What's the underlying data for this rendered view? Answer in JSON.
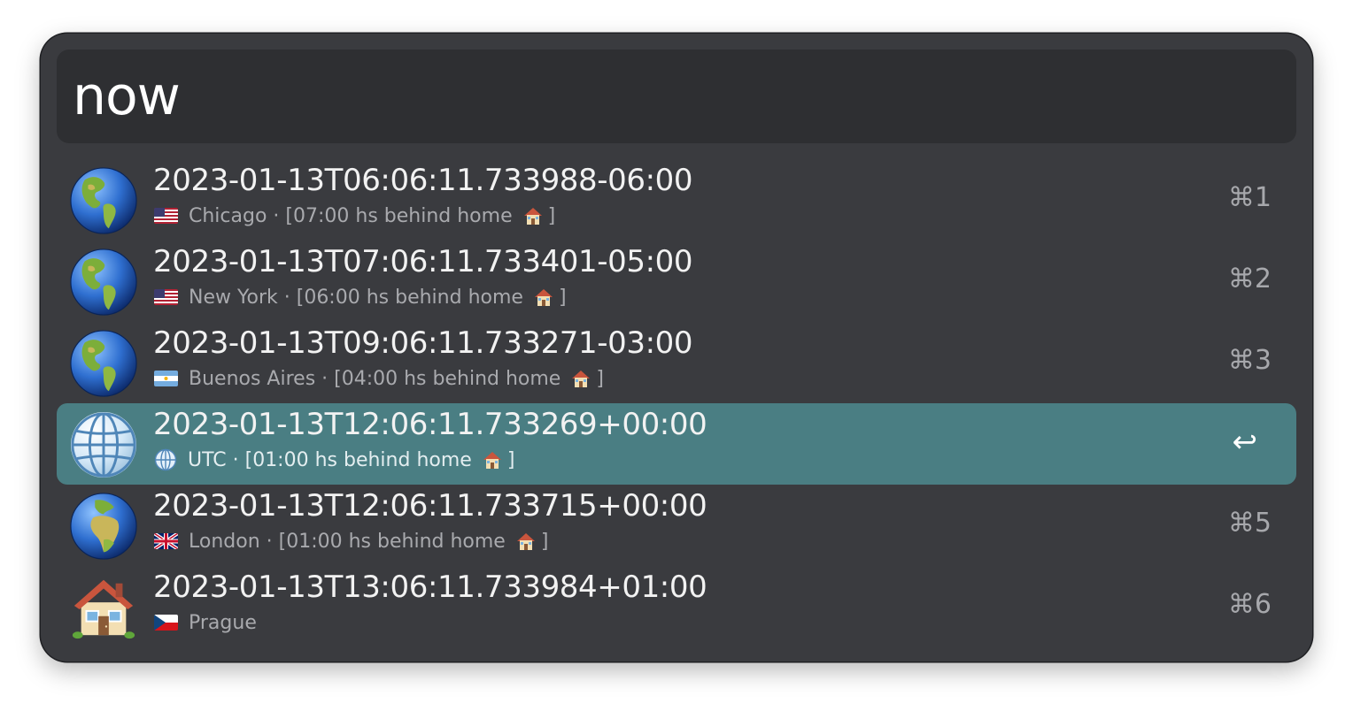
{
  "search": {
    "value": "now"
  },
  "results": [
    {
      "icon": "globe-americas-icon",
      "title": "2023-01-13T06:06:11.733988-06:00",
      "flag": "us-flag-icon",
      "city": "Chicago",
      "separator": " · ",
      "offset": "[07:00 hs behind home",
      "home_emoji": "house-icon",
      "close": "]",
      "shortcut": "⌘1"
    },
    {
      "icon": "globe-americas-icon",
      "title": "2023-01-13T07:06:11.733401-05:00",
      "flag": "us-flag-icon",
      "city": "New York",
      "separator": " · ",
      "offset": "[06:00 hs behind home",
      "home_emoji": "house-icon",
      "close": "]",
      "shortcut": "⌘2"
    },
    {
      "icon": "globe-americas-icon",
      "title": "2023-01-13T09:06:11.733271-03:00",
      "flag": "ar-flag-icon",
      "city": "Buenos Aires",
      "separator": " · ",
      "offset": "[04:00 hs behind home",
      "home_emoji": "house-icon",
      "close": "]",
      "shortcut": "⌘3"
    },
    {
      "icon": "globe-meridians-icon",
      "title": "2023-01-13T12:06:11.733269+00:00",
      "flag": "globe-meridians-icon",
      "city": "UTC",
      "separator": " · ",
      "offset": "[01:00 hs behind home",
      "home_emoji": "house-icon",
      "close": "]",
      "shortcut": "↩",
      "selected": true
    },
    {
      "icon": "globe-europe-africa-icon",
      "title": "2023-01-13T12:06:11.733715+00:00",
      "flag": "uk-flag-icon",
      "city": "London",
      "separator": " · ",
      "offset": "[01:00 hs behind home",
      "home_emoji": "house-icon",
      "close": "]",
      "shortcut": "⌘5"
    },
    {
      "icon": "house-icon",
      "title": "2023-01-13T13:06:11.733984+01:00",
      "flag": "cz-flag-icon",
      "city": "Prague",
      "shortcut": "⌘6"
    }
  ],
  "colors": {
    "window_bg": "#3a3b3f",
    "search_bg": "#2e2f32",
    "selected_bg": "#4a7e83",
    "title_text": "#f2f2f2",
    "subtitle_text": "#a9aaae"
  }
}
